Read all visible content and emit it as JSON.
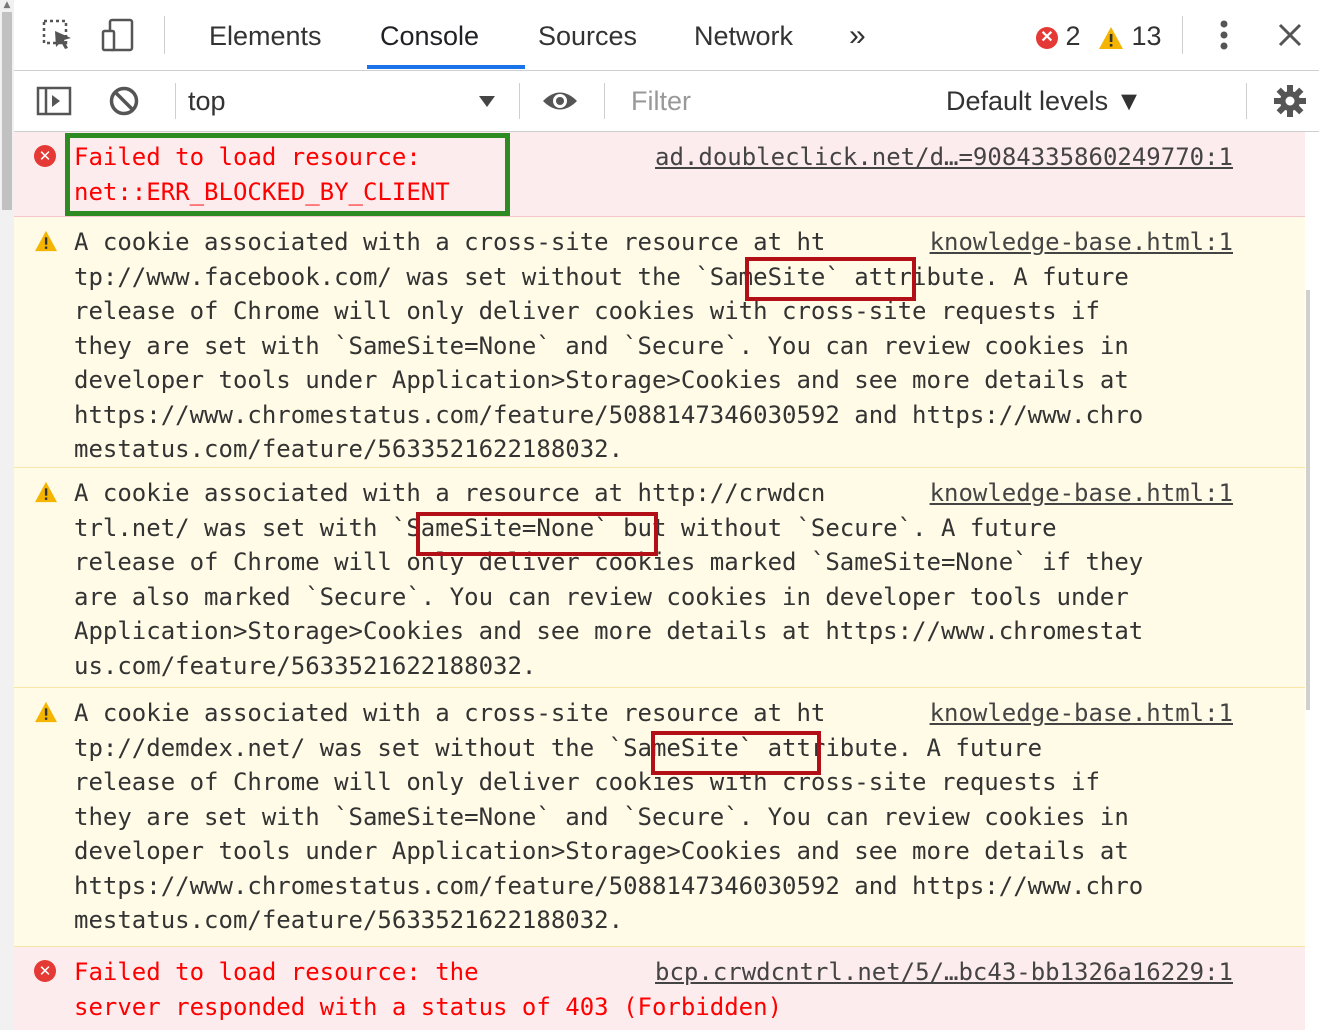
{
  "toolbar": {
    "tabs": [
      "Elements",
      "Console",
      "Sources",
      "Network"
    ],
    "more_tabs": "»",
    "error_count": "2",
    "warning_count": "13"
  },
  "filterbar": {
    "context": "top",
    "filter_placeholder": "Filter",
    "levels": "Default levels ▼"
  },
  "messages": [
    {
      "level": "error",
      "lines": [
        "Failed to load resource:",
        "net::ERR_BLOCKED_BY_CLIENT"
      ],
      "source": "ad.doubleclick.net/d…=9084335860249770:1"
    },
    {
      "level": "warning",
      "lines": [
        "A cookie associated with a cross-site resource at ht",
        "tp://www.facebook.com/ was set without the `SameSite` attribute. A future",
        "release of Chrome will only deliver cookies with cross-site requests if",
        "they are set with `SameSite=None` and `Secure`. You can review cookies in",
        "developer tools under Application>Storage>Cookies and see more details at",
        "https://www.chromestatus.com/feature/5088147346030592 and https://www.chro",
        "mestatus.com/feature/5633521622188032."
      ],
      "source": "knowledge-base.html:1"
    },
    {
      "level": "warning",
      "lines": [
        "A cookie associated with a resource at http://crwdcn",
        "trl.net/ was set with `SameSite=None` but without `Secure`. A future",
        "release of Chrome will only deliver cookies marked `SameSite=None` if they",
        "are also marked `Secure`. You can review cookies in developer tools under",
        "Application>Storage>Cookies and see more details at https://www.chromestat",
        "us.com/feature/5633521622188032."
      ],
      "source": "knowledge-base.html:1"
    },
    {
      "level": "warning",
      "lines": [
        "A cookie associated with a cross-site resource at ht",
        "tp://demdex.net/ was set without the `SameSite` attribute. A future",
        "release of Chrome will only deliver cookies with cross-site requests if",
        "they are set with `SameSite=None` and `Secure`. You can review cookies in",
        "developer tools under Application>Storage>Cookies and see more details at",
        "https://www.chromestatus.com/feature/5088147346030592 and https://www.chro",
        "mestatus.com/feature/5633521622188032."
      ],
      "source": "knowledge-base.html:1"
    },
    {
      "level": "error",
      "lines": [
        "Failed to load resource: the",
        "server responded with a status of 403 (Forbidden)"
      ],
      "source": "bcp.crwdcntrl.net/5/…bc43-bb1326a16229:1"
    }
  ],
  "colors": {
    "accent": "#1a73e8",
    "error_bg": "#fdecee",
    "warning_bg": "#fffbe6",
    "highlight_red": "#b30f16",
    "highlight_green": "#2e8b22"
  }
}
